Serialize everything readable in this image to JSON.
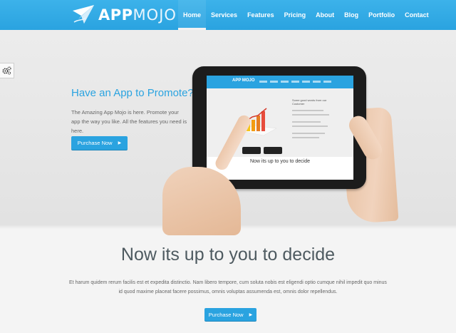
{
  "header": {
    "logo_text_a": "APP",
    "logo_text_b": "MOJO",
    "nav": [
      "Home",
      "Services",
      "Features",
      "Pricing",
      "About",
      "Blog",
      "Portfolio",
      "Contact"
    ],
    "active_nav": "Home"
  },
  "hero": {
    "title": "Have an App to Promote?",
    "description": "The Amazing App Mojo is here. Promote your app the way you like. All the features you need is here.",
    "button_label": "Purchase Now",
    "tablet_screen": {
      "logo": "APP MOJO",
      "headline": "Some good words from our Customer",
      "title": "Now its up to you to decide"
    }
  },
  "lower": {
    "title": "Now its up to you to decide",
    "text": "Et harum quidem rerum facilis est et expedita distinctio. Nam libero tempore, cum soluta nobis est eligendi optio cumque nihil impedit quo minus id quod maxime placeat facere possimus, omnis voluptas assumenda est, omnis dolor repellendus.",
    "button_label": "Purchase Now"
  },
  "icons": {
    "settings": "gears-icon",
    "button_arrow": "chevron-right-icon",
    "logo_mark": "paper-plane-icon"
  },
  "colors": {
    "brand_blue": "#2aa3e0",
    "header_top": "#3cb2ea",
    "title_gray": "#4e5a60"
  }
}
